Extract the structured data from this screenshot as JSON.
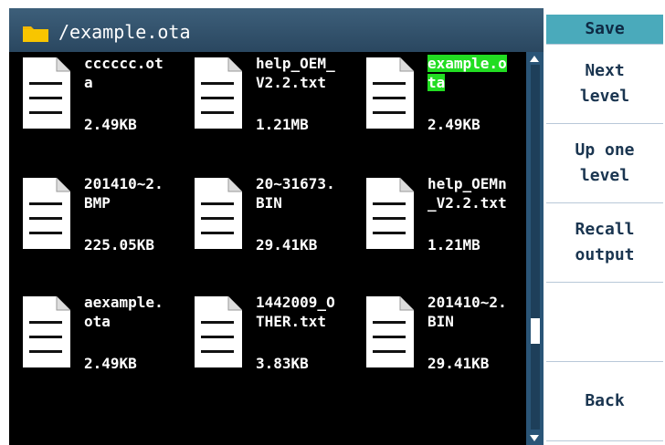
{
  "header": {
    "path": "/example.ota",
    "folder_icon": "folder-icon",
    "folder_color": "#f5b800"
  },
  "files": [
    {
      "name": "cccccc.ot\na",
      "size": "2.49KB",
      "selected": false
    },
    {
      "name": "help_OEM_\nV2.2.txt",
      "size": "1.21MB",
      "selected": false
    },
    {
      "name": "example.o\nta",
      "size": "2.49KB",
      "selected": true
    },
    {
      "name": "201410~2.\nBMP",
      "size": "225.05KB",
      "selected": false
    },
    {
      "name": "20~31673.\nBIN",
      "size": "29.41KB",
      "selected": false
    },
    {
      "name": "help_OEMn\n_V2.2.txt",
      "size": "1.21MB",
      "selected": false
    },
    {
      "name": "aexample.\nota",
      "size": "2.49KB",
      "selected": false
    },
    {
      "name": "1442009_O\nTHER.txt",
      "size": "3.83KB",
      "selected": false
    },
    {
      "name": "201410~2.\nBIN",
      "size": "29.41KB",
      "selected": false
    }
  ],
  "menu": {
    "title": "Save",
    "items": [
      {
        "label": "Next\nlevel"
      },
      {
        "label": "Up one\nlevel"
      },
      {
        "label": "Recall\noutput"
      },
      {
        "label": ""
      },
      {
        "label": "Back"
      }
    ]
  },
  "colors": {
    "accent": "#4aaabb",
    "selection": "#22dd22",
    "header_bg": "#2e4d66",
    "scrollbar": "#2a5577"
  },
  "scroll_position": 0.7
}
